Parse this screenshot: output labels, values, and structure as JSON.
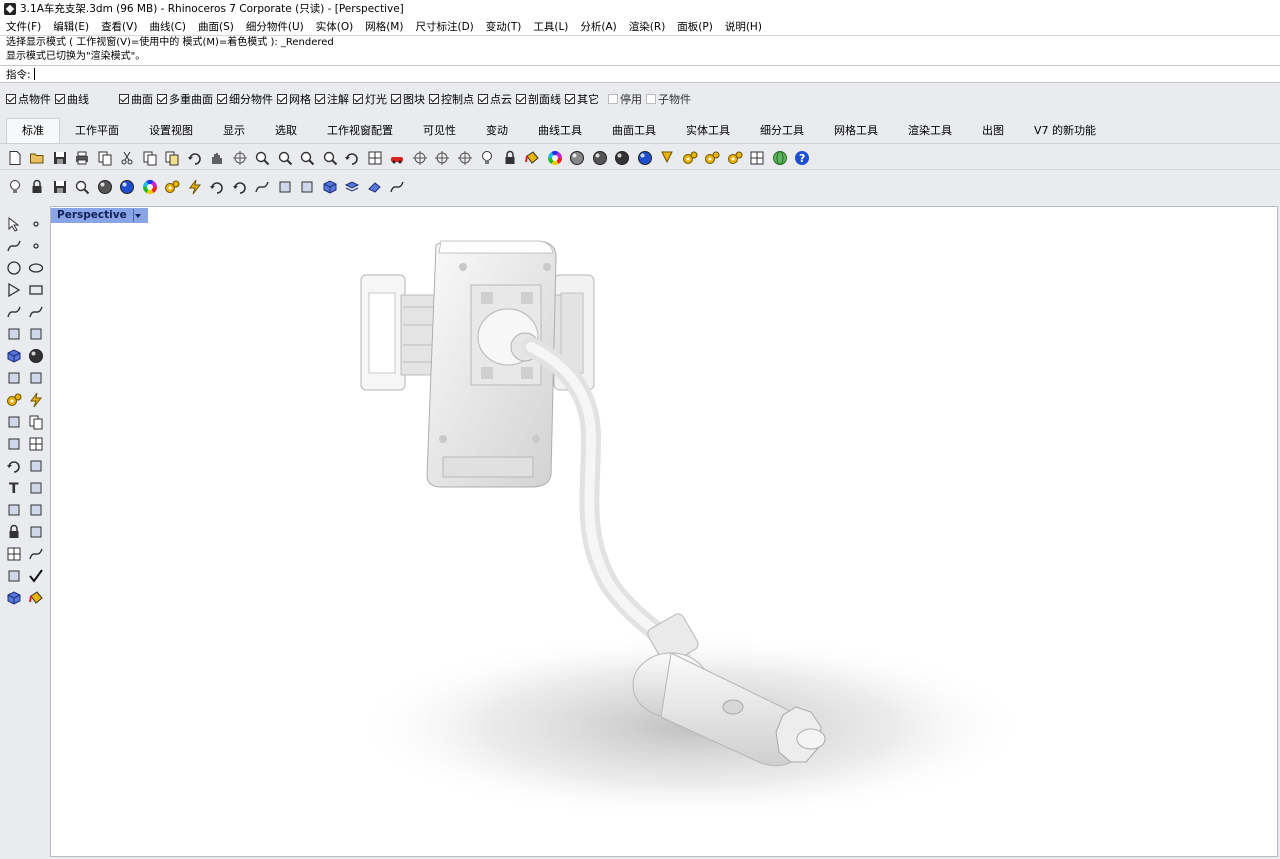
{
  "window": {
    "title": "3.1A车充支架.3dm (96 MB) - Rhinoceros 7 Corporate (只读) - [Perspective]"
  },
  "menu": [
    "文件(F)",
    "编辑(E)",
    "查看(V)",
    "曲线(C)",
    "曲面(S)",
    "细分物件(U)",
    "实体(O)",
    "网格(M)",
    "尺寸标注(D)",
    "变动(T)",
    "工具(L)",
    "分析(A)",
    "渲染(R)",
    "面板(P)",
    "说明(H)"
  ],
  "command_history": [
    "选择显示模式 ( 工作视窗(V)=使用中的  模式(M)=着色模式 ): _Rendered",
    "显示模式已切换为\"渲染模式\"。"
  ],
  "command_prompt": "指令:",
  "osnap": [
    {
      "label": "点物件",
      "checked": true
    },
    {
      "label": "曲线",
      "checked": true
    },
    {
      "label": "曲面",
      "checked": true
    },
    {
      "label": "多重曲面",
      "checked": true
    },
    {
      "label": "细分物件",
      "checked": true
    },
    {
      "label": "网格",
      "checked": true
    },
    {
      "label": "注解",
      "checked": true
    },
    {
      "label": "灯光",
      "checked": true
    },
    {
      "label": "图块",
      "checked": true
    },
    {
      "label": "控制点",
      "checked": true
    },
    {
      "label": "点云",
      "checked": true
    },
    {
      "label": "剖面线",
      "checked": true
    },
    {
      "label": "其它",
      "checked": true
    },
    {
      "label": "停用",
      "checked": false,
      "disabled": true
    },
    {
      "label": "子物件",
      "checked": false,
      "disabled": true
    }
  ],
  "tabs": [
    "标准",
    "工作平面",
    "设置视图",
    "显示",
    "选取",
    "工作视窗配置",
    "可见性",
    "变动",
    "曲线工具",
    "曲面工具",
    "实体工具",
    "细分工具",
    "网格工具",
    "渲染工具",
    "出图",
    "V7 的新功能"
  ],
  "active_tab": "标准",
  "toolbar_row1": [
    "new-icon",
    "open-icon",
    "save-icon",
    "print-icon",
    "import-icon",
    "cut-icon",
    "copy-icon",
    "paste-icon",
    "undo-icon",
    "pan-icon",
    "move-view-icon",
    "zoom-window-icon",
    "zoom-extents-icon",
    "zoom-all-icon",
    "zoom-selected-icon",
    "rotate-view-icon",
    "four-views-icon",
    "car-icon",
    "camera-icon",
    "cplane-icon",
    "object-snap-icon",
    "light-icon",
    "lock-icon",
    "paint-bucket-icon",
    "color-wheel-icon",
    "render-sphere-icon",
    "shaded-sphere-icon",
    "material-sphere-icon",
    "blue-sphere-icon",
    "annotate-icon",
    "gear-icon",
    "gears-icon",
    "gears-options-icon",
    "grid-icon",
    "globe-icon",
    "help-icon"
  ],
  "toolbar_row2": [
    "light-icon",
    "lock-icon",
    "save-icon",
    "zoom-icon",
    "shaded-sphere-icon",
    "blue-sphere-icon",
    "color-wheel-icon",
    "gears-icon",
    "bolt-icon",
    "rotate-icon",
    "flip-icon",
    "curve-icon",
    "brush-icon",
    "base-icon",
    "box-icon",
    "layer-icon",
    "eraser-icon",
    "line-icon"
  ],
  "left_toolbar": [
    "select-icon",
    "point-icon",
    "polyline-icon",
    "curve-points-icon",
    "circle-icon",
    "ellipse-icon",
    "polygon-icon",
    "rectangle-icon",
    "arc-icon",
    "fillet-curve-icon",
    "surface-icon",
    "loft-icon",
    "box-icon",
    "sphere-icon",
    "cylinder-icon",
    "extrude-icon",
    "gears-icon",
    "explode-icon",
    "move-icon",
    "copy-icon",
    "boolean-icon",
    "array-icon",
    "rotate-icon",
    "scale-icon",
    "text-icon",
    "transform-icon",
    "group-icon",
    "dimension-icon",
    "block-icon",
    "ruler-icon",
    "grid-array-icon",
    "pipe-icon",
    "align-icon",
    "check-icon",
    "solid-edit-icon",
    "paint-icon"
  ],
  "viewport": {
    "label": "Perspective"
  },
  "colors": {
    "viewport_tab": "#8aa5e6",
    "accent": "#1e4fd0"
  }
}
